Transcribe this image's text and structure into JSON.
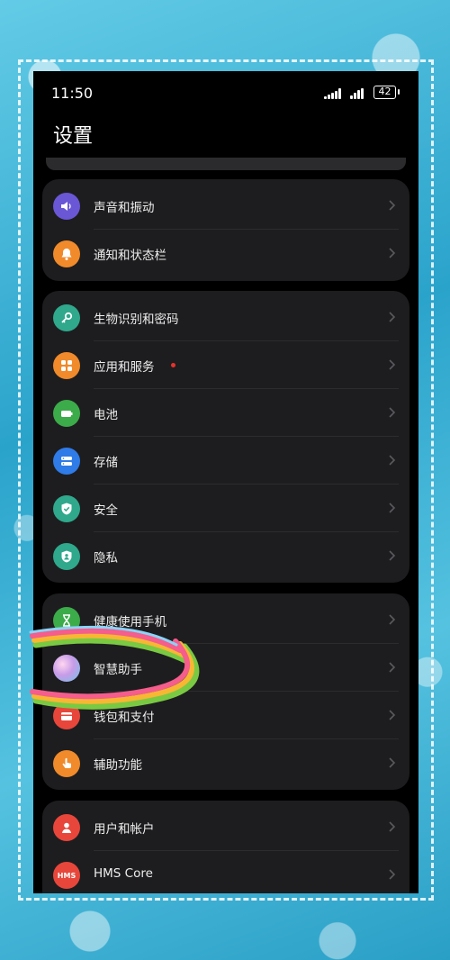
{
  "status_bar": {
    "time": "11:50",
    "battery": "42"
  },
  "page": {
    "title": "设置"
  },
  "groups": [
    {
      "items": [
        {
          "label": "声音和振动",
          "icon": "speaker-icon",
          "color": "#6a57d6"
        },
        {
          "label": "通知和状态栏",
          "icon": "bell-icon",
          "color": "#f08a2a"
        }
      ]
    },
    {
      "items": [
        {
          "label": "生物识别和密码",
          "icon": "key-icon",
          "color": "#2fa88c"
        },
        {
          "label": "应用和服务",
          "icon": "apps-icon",
          "color": "#f08a2a",
          "badge": "red-dot"
        },
        {
          "label": "电池",
          "icon": "battery-icon",
          "color": "#3cab4a"
        },
        {
          "label": "存储",
          "icon": "storage-icon",
          "color": "#2f7be8"
        },
        {
          "label": "安全",
          "icon": "shield-check-icon",
          "color": "#2fa88c"
        },
        {
          "label": "隐私",
          "icon": "privacy-shield-icon",
          "color": "#2fa88c"
        }
      ]
    },
    {
      "items": [
        {
          "label": "健康使用手机",
          "icon": "hourglass-icon",
          "color": "#3cab4a"
        },
        {
          "label": "智慧助手",
          "icon": "assistant-orb-icon",
          "color": "#b98ad6"
        },
        {
          "label": "钱包和支付",
          "icon": "wallet-icon",
          "color": "#e8463b"
        },
        {
          "label": "辅助功能",
          "icon": "hand-icon",
          "color": "#f08a2a"
        }
      ]
    },
    {
      "items": [
        {
          "label": "用户和帐户",
          "icon": "user-icon",
          "color": "#e8463b"
        },
        {
          "label": "HMS Core",
          "icon": "hms-icon",
          "icon_text": "HMS",
          "color": "#e8463b"
        }
      ]
    }
  ]
}
